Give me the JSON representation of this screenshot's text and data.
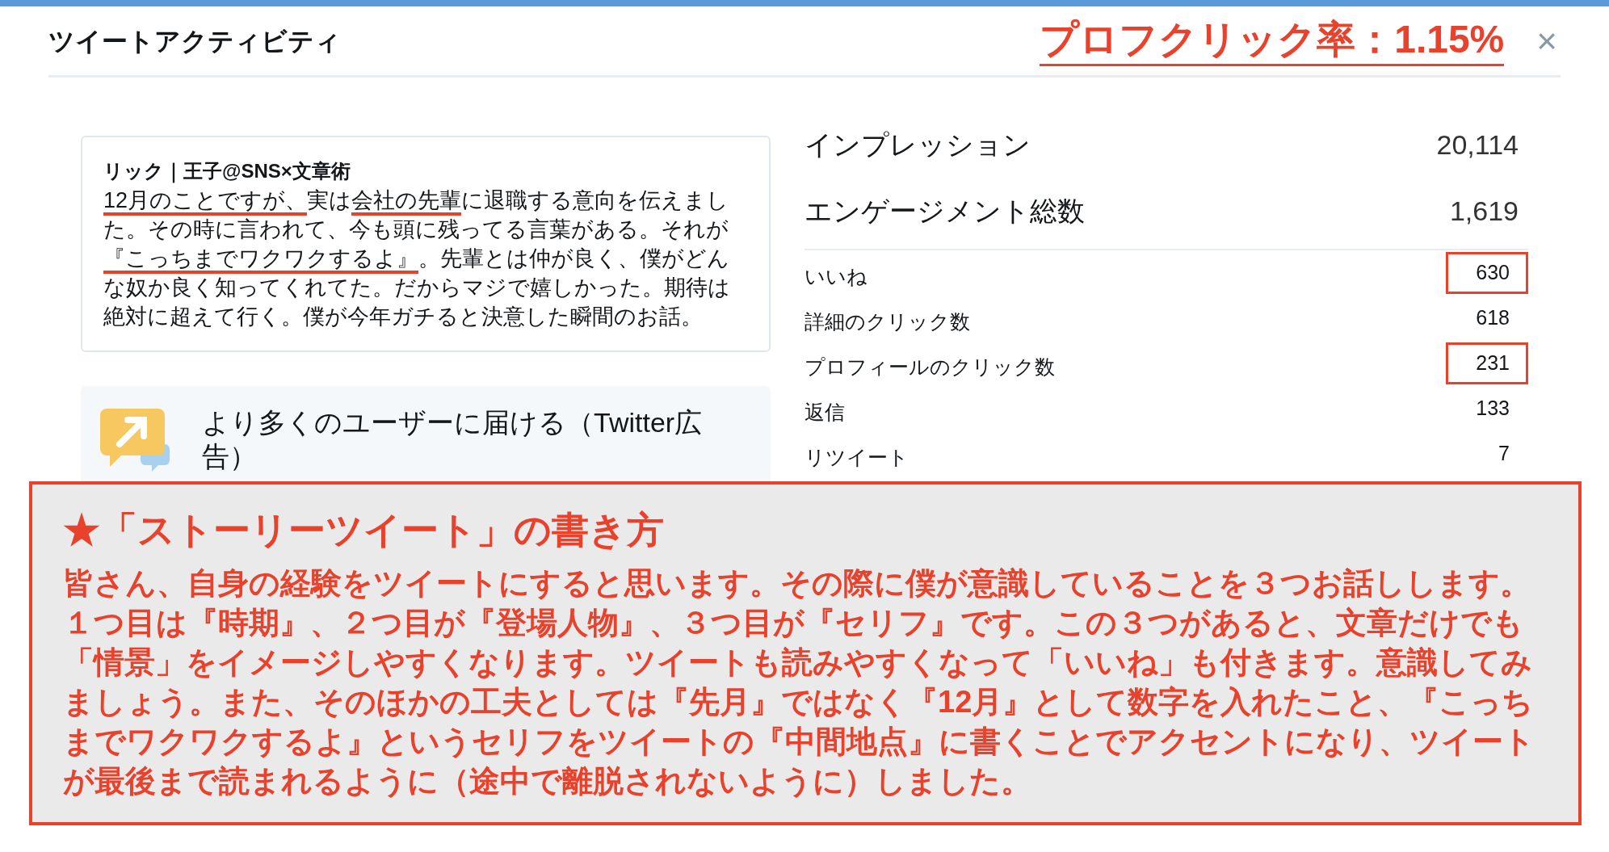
{
  "header": {
    "title": "ツイートアクティビティ",
    "annotation": "プロフクリック率：1.15%",
    "close": "×"
  },
  "tweet": {
    "author": "リック｜王子@SNS×文章術",
    "segments": [
      {
        "text": "12月のことですが、",
        "underlined": true
      },
      {
        "text": "実は",
        "underlined": false
      },
      {
        "text": "会社の先輩",
        "underlined": true
      },
      {
        "text": "に退職する意向を伝えました。その時に言われて、今も頭に残ってる言葉がある。それが",
        "underlined": false
      },
      {
        "text": "『こっちまでワクワクするよ』",
        "underlined": true
      },
      {
        "text": "。先輩とは仲が良く、僕がどんな奴か良く知ってくれてた。だからマジで嬉しかった。期待は絶対に超えて行く。僕が今年ガチると決意した瞬間のお話。",
        "underlined": false
      }
    ]
  },
  "promo": {
    "title": "より多くのユーザーに届ける（Twitter広告）"
  },
  "summary": [
    {
      "label": "インプレッション",
      "value": "20,114"
    },
    {
      "label": "エンゲージメント総数",
      "value": "1,619"
    }
  ],
  "metrics": [
    {
      "label": "いいね",
      "value": "630",
      "highlighted": true
    },
    {
      "label": "詳細のクリック数",
      "value": "618",
      "highlighted": false
    },
    {
      "label": "プロフィールのクリック数",
      "value": "231",
      "highlighted": true
    },
    {
      "label": "返信",
      "value": "133",
      "highlighted": false
    },
    {
      "label": "リツイート",
      "value": "7",
      "highlighted": false
    }
  ],
  "note": {
    "title": "★「ストーリーツイート」の書き方",
    "body": "皆さん、自身の経験をツイートにすると思います。その際に僕が意識していることを３つお話しします。１つ目は『時期』、２つ目が『登場人物』、３つ目が『セリフ』です。この３つがあると、文章だけでも「情景」をイメージしやすくなります。ツイートも読みやすくなって「いいね」も付きます。意識してみましょう。また、そのほかの工夫としては『先月』ではなく『12月』として数字を入れたこと、『こっちまでワクワクするよ』というセリフをツイートの『中間地点』に書くことでアクセントになり、ツイートが最後まで読まれるように（途中で離脱されないように）しました。"
  }
}
